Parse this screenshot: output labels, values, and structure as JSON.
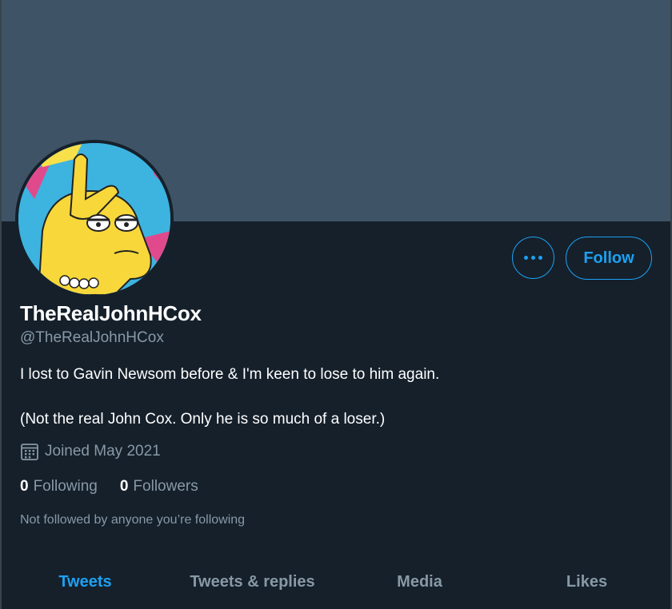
{
  "profile": {
    "display_name": "TheRealJohnHCox",
    "handle": "@TheRealJohnHCox",
    "bio_line_1": "I lost to Gavin Newsom before & I'm keen to lose to him again.",
    "bio_line_2": "(Not the real John Cox. Only he is so much of a loser.)",
    "joined": "Joined May 2021",
    "following_count": "0",
    "following_label": "Following",
    "followers_count": "0",
    "followers_label": "Followers",
    "not_followed_text": "Not followed by anyone you’re following"
  },
  "actions": {
    "more_icon": "more-horizontal-icon",
    "follow_label": "Follow"
  },
  "tabs": [
    {
      "label": "Tweets",
      "active": true
    },
    {
      "label": "Tweets & replies",
      "active": false
    },
    {
      "label": "Media",
      "active": false
    },
    {
      "label": "Likes",
      "active": false
    }
  ],
  "colors": {
    "background": "#15202b",
    "banner": "#3e5366",
    "accent": "#1da1f2",
    "secondary_text": "#8899a6"
  },
  "icons": {
    "calendar": "calendar-icon",
    "avatar": "avatar-image"
  }
}
